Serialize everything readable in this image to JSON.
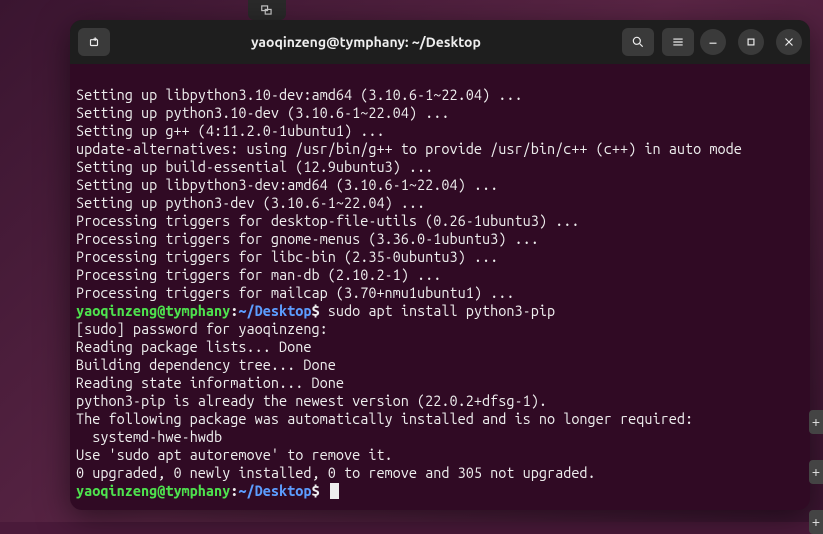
{
  "titlebar": {
    "title": "yaoqinzeng@tymphany: ~/Desktop"
  },
  "prompt": {
    "user_host": "yaoqinzeng@tymphany",
    "sep": ":",
    "path": "~/Desktop",
    "dollar": "$"
  },
  "lines_pre": [
    "Setting up libpython3.10-dev:amd64 (3.10.6-1~22.04) ...",
    "Setting up python3.10-dev (3.10.6-1~22.04) ...",
    "Setting up g++ (4:11.2.0-1ubuntu1) ...",
    "update-alternatives: using /usr/bin/g++ to provide /usr/bin/c++ (c++) in auto mode",
    "Setting up build-essential (12.9ubuntu3) ...",
    "Setting up libpython3-dev:amd64 (3.10.6-1~22.04) ...",
    "Setting up python3-dev (3.10.6-1~22.04) ...",
    "Processing triggers for desktop-file-utils (0.26-1ubuntu3) ...",
    "Processing triggers for gnome-menus (3.36.0-1ubuntu3) ...",
    "Processing triggers for libc-bin (2.35-0ubuntu3) ...",
    "Processing triggers for man-db (2.10.2-1) ...",
    "Processing triggers for mailcap (3.70+nmu1ubuntu1) ..."
  ],
  "command1": " sudo apt install python3-pip",
  "lines_post": [
    "[sudo] password for yaoqinzeng:",
    "Reading package lists... Done",
    "Building dependency tree... Done",
    "Reading state information... Done",
    "python3-pip is already the newest version (22.0.2+dfsg-1).",
    "The following package was automatically installed and is no longer required:",
    "  systemd-hwe-hwdb",
    "Use 'sudo apt autoremove' to remove it.",
    "0 upgraded, 0 newly installed, 0 to remove and 305 not upgraded."
  ]
}
